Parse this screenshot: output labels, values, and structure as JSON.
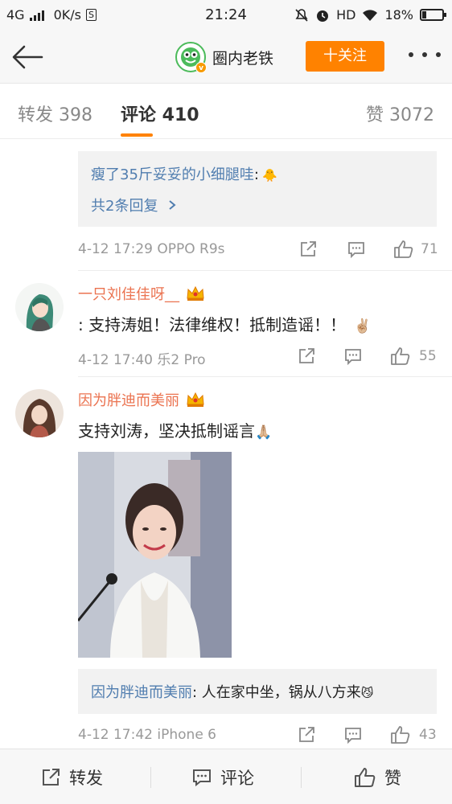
{
  "status_bar": {
    "network": "4G",
    "speed": "0K/s",
    "time": "21:24",
    "hd": "HD",
    "battery": "18%"
  },
  "header": {
    "account_name": "圈内老铁",
    "follow_label": "十关注"
  },
  "tabs": {
    "repost": "转发 398",
    "comments": "评论 410",
    "likes": "赞 3072"
  },
  "comments": [
    {
      "reply_preview": {
        "user": "瘦了35斤妥妥的小细腿哇",
        "colon": ":",
        "emoji": "🐥",
        "more": "共2条回复"
      },
      "time": "4-12 17:29",
      "device": "OPPO R9s",
      "likes": "71"
    },
    {
      "user": "一只刘佳佳呀__",
      "text": ": 支持涛姐！法律维权！抵制造谣！！",
      "emoji": "✌🏼",
      "time": "4-12 17:40",
      "device": "乐2 Pro",
      "likes": "55"
    },
    {
      "user": "因为胖迪而美丽",
      "text": "支持刘涛，坚决抵制谣言",
      "emoji": "🙏🏼",
      "reply_preview": {
        "user": "因为胖迪而美丽",
        "text": ": 人在家中坐，锅从八方来",
        "emoji": "😼"
      },
      "time": "4-12 17:42",
      "device": "iPhone 6",
      "likes": "43"
    }
  ],
  "bottom_bar": {
    "repost": "转发",
    "comment": "评论",
    "like": "赞"
  },
  "colors": {
    "accent": "#ff8200",
    "username": "#eb7350",
    "link": "#507daf"
  }
}
